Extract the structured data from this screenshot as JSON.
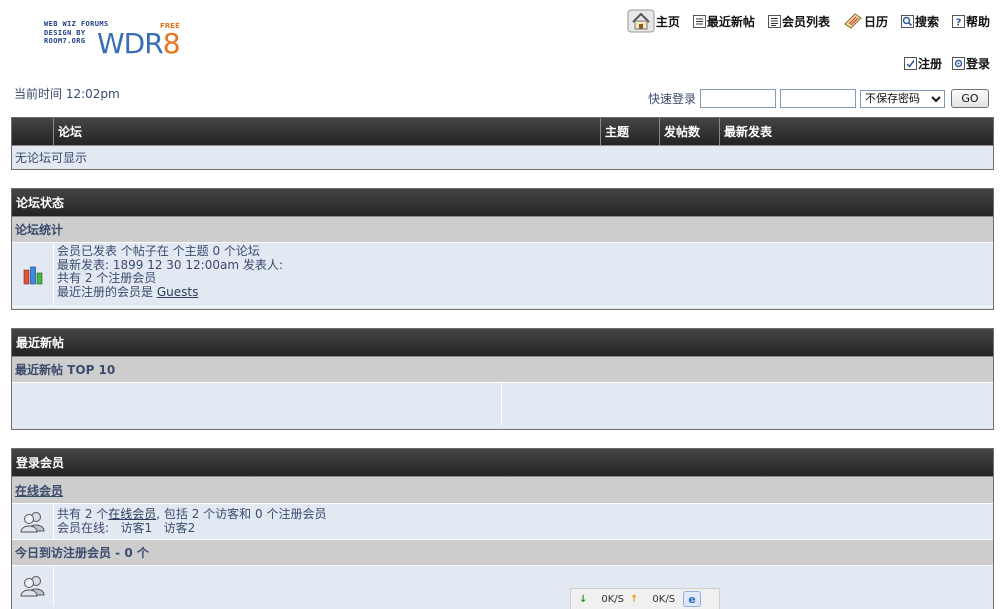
{
  "logo": {
    "line1": "WEB WIZ FORUMS",
    "line2": "DESIGN BY",
    "line3": "ROOM7.ORG",
    "free": "FREE",
    "wdr": "WDR",
    "eight": "8"
  },
  "nav": {
    "home": "主页",
    "recent": "最近新帖",
    "members": "会员列表",
    "calendar": "日历",
    "search": "搜索",
    "help": "帮助",
    "register": "注册",
    "login": "登录"
  },
  "current_time": "当前时间 12:02pm",
  "quick_login": {
    "label": "快速登录",
    "username_value": "",
    "password_value": "",
    "remember_selected": "不保存密码",
    "go": "GO"
  },
  "forums_table": {
    "columns": [
      "",
      "论坛",
      "主题",
      "发帖数",
      "最新发表"
    ],
    "empty": "无论坛可显示"
  },
  "forum_status": {
    "title": "论坛状态",
    "stats_heading": "论坛统计",
    "line1": "会员已发表 个帖子在 个主题 0 个论坛",
    "line2": "最新发表: 1899 12 30 12:00am 发表人:",
    "line3": "共有 2 个注册会员",
    "line4_prefix": "最近注册的会员是 ",
    "line4_link": "Guests"
  },
  "recent_posts": {
    "title": "最近新帖",
    "heading": "最近新帖 TOP 10"
  },
  "logged_members": {
    "title": "登录会员",
    "online_heading": "在线会员",
    "online_line1_prefix": "共有 2 个",
    "online_line1_link": "在线会员",
    "online_line1_suffix": ", 包括 2 个访客和 0 个注册会员",
    "online_line2": "会员在线:   访客1   访客2",
    "today_heading": "今日到访注册会员 - 0 个"
  },
  "net_widget": {
    "down_rate": "0K/S",
    "up_rate": "0K/S"
  }
}
